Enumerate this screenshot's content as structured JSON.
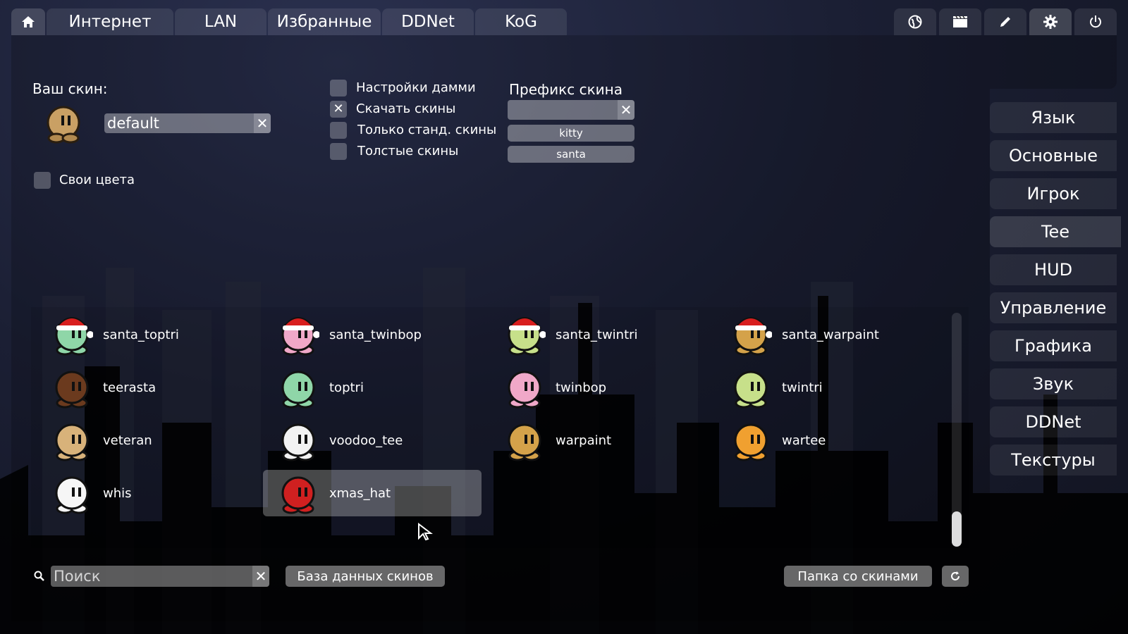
{
  "tabs": {
    "home_icon": "home-icon",
    "items": [
      "Интернет",
      "LAN",
      "Избранные",
      "DDNet",
      "KoG"
    ],
    "right_icons": [
      "globe-icon",
      "demo-icon",
      "editor-icon",
      "settings-icon",
      "power-icon"
    ],
    "active_right": "settings-icon"
  },
  "side_menu": {
    "items": [
      "Язык",
      "Основные",
      "Игрок",
      "Tee",
      "HUD",
      "Управление",
      "Графика",
      "Звук",
      "DDNet",
      "Текстуры"
    ],
    "active": "Tee"
  },
  "skin_settings": {
    "your_skin_label": "Ваш скин:",
    "skin_value": "default",
    "custom_colors_label": "Свои цвета",
    "custom_colors_checked": false
  },
  "options": {
    "checkboxes": [
      {
        "label": "Настройки дамми",
        "checked": false
      },
      {
        "label": "Скачать скины",
        "checked": true
      },
      {
        "label": "Только станд. скины",
        "checked": false
      },
      {
        "label": "Толстые скины",
        "checked": false
      }
    ],
    "prefix_label": "Префикс скина",
    "prefix_value": "",
    "prefix_options": [
      "kitty",
      "santa"
    ]
  },
  "skins": [
    {
      "name": "santa_toptri",
      "body": "#8fd6a8",
      "hat": true
    },
    {
      "name": "santa_twinbop",
      "body": "#f0a8c8",
      "hat": true
    },
    {
      "name": "santa_twintri",
      "body": "#c7e08a",
      "hat": true
    },
    {
      "name": "santa_warpaint",
      "body": "#d4a24a",
      "hat": true
    },
    {
      "name": "teerasta",
      "body": "#6b3a1e",
      "hat": false
    },
    {
      "name": "toptri",
      "body": "#8fd6a8",
      "hat": false
    },
    {
      "name": "twinbop",
      "body": "#f0a8c8",
      "hat": false
    },
    {
      "name": "twintri",
      "body": "#c7e08a",
      "hat": false
    },
    {
      "name": "veteran",
      "body": "#d8b27a",
      "hat": false
    },
    {
      "name": "voodoo_tee",
      "body": "#f2f2f2",
      "hat": false
    },
    {
      "name": "warpaint",
      "body": "#d4a24a",
      "hat": false
    },
    {
      "name": "wartee",
      "body": "#f0a030",
      "hat": false
    },
    {
      "name": "whis",
      "body": "#f6f6f6",
      "hat": false
    },
    {
      "name": "xmas_hat",
      "body": "#d02020",
      "hat": false,
      "selected": true
    }
  ],
  "bottom": {
    "search_placeholder": "Поиск",
    "search_icon": "search-icon",
    "database_button": "База данных скинов",
    "folder_button": "Папка со скинами",
    "refresh_icon": "refresh-icon"
  }
}
